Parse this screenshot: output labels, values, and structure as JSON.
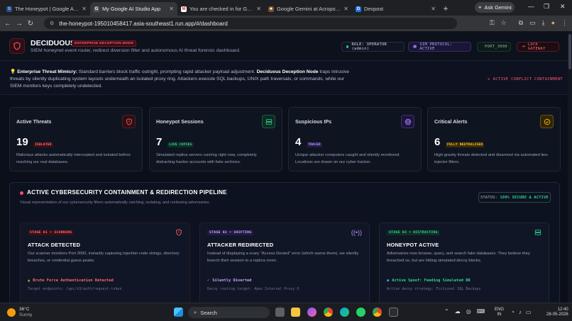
{
  "browser": {
    "tabs": [
      {
        "title": "The Honeypot | Google AI Stud",
        "icon": "S"
      },
      {
        "title": "My Google AI Studio App",
        "icon": "G"
      },
      {
        "title": "You are checked in for Googl",
        "icon": "M"
      },
      {
        "title": "Google Gemini at Acropolis | M",
        "icon": "★"
      },
      {
        "title": "Devpost",
        "icon": "D"
      }
    ],
    "ask_gemini": "Ask Gemini",
    "url": "the-honeypot-195010458417.asia-southeast1.run.app/#/dashboard"
  },
  "header": {
    "brand": "DECIDUOUS",
    "badge": "ENTERPRISE DECEPTION MODE",
    "subtitle": "SIEM honeynet event router, redirect diversion filter and autonomous AI threat forensic dashboard.",
    "role": "ROLE: OPERATOR (admin)",
    "sim": "SIM PROTOCOL: ACTIVE",
    "port": "PORT_3000",
    "lock": "LOCK GATEWAY"
  },
  "banner": {
    "lead": "Enterprise Threat Mimicry:",
    "text1": " Standard barriers block traffic outright, prompting rapid attacker payload adjustment. ",
    "node": "Deciduous Deception Node",
    "text2": " traps intrusive threats by silently duplicating system layouts underneath an isolated proxy ring. Attackers execute SQL backups, UNIX path traversals, or commands, while our SIEM monitors keys completely undetected.",
    "conflict": "ACTIVE CONFLICT CONTAINMENT"
  },
  "cards": [
    {
      "title": "Active Threats",
      "value": "19",
      "tag": "ISOLATED",
      "desc": "Malicious attacks automatically intercepted and isolated before reaching our real databases.",
      "color": "#ff4d5e"
    },
    {
      "title": "Honeypot Sessions",
      "value": "7",
      "tag": "LIVE COPIES",
      "desc": "Simulated replica servers running right now, completely distracting hacker accounts with fake archives.",
      "color": "#22c98a"
    },
    {
      "title": "Suspicious IPs",
      "value": "4",
      "tag": "TRACED",
      "desc": "Unique attacker computers caught and silently monitored. Locations are drawn on our cyber tracker.",
      "color": "#9b7bff"
    },
    {
      "title": "Critical Alerts",
      "value": "6",
      "tag": "FULLY NEUTRALISED",
      "desc": "High-gravity threats detected and disarmed via automated lies-injector filters.",
      "color": "#f5b301"
    }
  ],
  "pipeline": {
    "title": "ACTIVE CYBERSECURITY CONTAINMENT & REDIRECTION PIPELINE",
    "subtitle": "Visual representation of our cybersecurity filters automatically catching, isolating, and confusing adversaries.",
    "status_label": "STATUS:",
    "status_value": "100% SECURE & ACTIVE",
    "stages": [
      {
        "tag": "STAGE 01 • SCANNING",
        "title": "ATTACK DETECTED",
        "desc": "Our scanner monitors Port 3000, instantly capturing injection code strings, directory breaches, or credential guess peaks.",
        "status": "Brute Force Authentication Detected",
        "foot": "Target endpoints: /api/v3/auth/request-token",
        "color": "#ff5a6a"
      },
      {
        "tag": "STAGE 02 • SHIFTING",
        "title": "ATTACKER REDIRECTED",
        "desc": "Instead of displaying a scary \"Access Denied\" error (which warns them), we silently branch their session to a replica room.",
        "status": "Silently Diverted",
        "foot": "Decoy routing target: Apex Internal Proxy 6",
        "color": "#b48cff"
      },
      {
        "tag": "STAGE 03 • DISTRACTING",
        "title": "HONEYPOT ACTIVE",
        "desc": "Adversaries now browse, query, and search fake databases. They believe they breached us, but are hitting simulated decoy blocks.",
        "status": "Active Spoof: Feeding Simulated DB",
        "foot": "Active decoy strategy: Fictional SQL Backups",
        "color": "#22c98a"
      }
    ]
  },
  "taskbar": {
    "temp": "36°C",
    "weather": "Sunny",
    "search": "Search",
    "lang1": "ENG",
    "lang2": "IN",
    "time": "12:40",
    "date": "28-05-2026"
  }
}
